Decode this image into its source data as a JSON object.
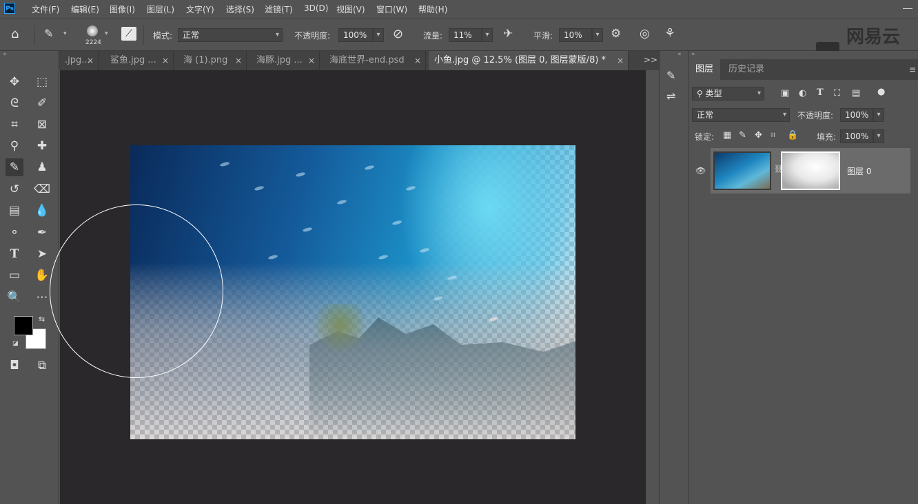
{
  "menubar": {
    "app_icon": "Ps",
    "items": [
      "文件(F)",
      "编辑(E)",
      "图像(I)",
      "图层(L)",
      "文字(Y)",
      "选择(S)",
      "滤镜(T)",
      "3D(D)",
      "视图(V)",
      "窗口(W)",
      "帮助(H)"
    ]
  },
  "options": {
    "brush_size": "2224",
    "mode_label": "模式:",
    "mode_value": "正常",
    "opacity_label": "不透明度:",
    "opacity_value": "100%",
    "flow_label": "流量:",
    "flow_value": "11%",
    "smoothing_label": "平滑:",
    "smoothing_value": "10%"
  },
  "watermark": {
    "text": "网易云"
  },
  "tabs": [
    {
      "label": ".jpg...",
      "close": "×"
    },
    {
      "label": "鲨鱼.jpg ...",
      "close": "×"
    },
    {
      "label": "海 (1).png",
      "close": "×"
    },
    {
      "label": "海豚.jpg ...",
      "close": "×"
    },
    {
      "label": "海底世界-end.psd",
      "close": "×"
    },
    {
      "label": "小鱼.jpg @ 12.5% (图层 0, 图层蒙版/8) *",
      "close": "×"
    }
  ],
  "tabs_overflow": ">>",
  "layers_panel": {
    "tab_layers": "图层",
    "tab_history": "历史记录",
    "filter_kind": "类型",
    "blend_mode": "正常",
    "opacity_label": "不透明度:",
    "opacity_value": "100%",
    "lock_label": "锁定:",
    "fill_label": "填充:",
    "fill_value": "100%",
    "layer_name": "图层 0"
  },
  "colors": {
    "foreground": "#000000",
    "background": "#ffffff",
    "panel_bg": "#535353",
    "canvas_bg": "#2a282b"
  }
}
